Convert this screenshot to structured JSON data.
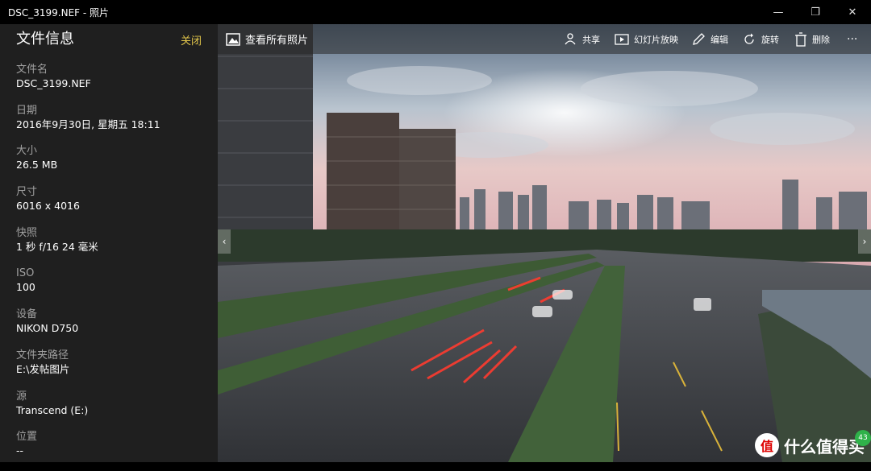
{
  "window": {
    "title": "DSC_3199.NEF - 照片",
    "minimize": "—",
    "maximize": "❐",
    "close": "✕"
  },
  "info_panel": {
    "title": "文件信息",
    "close_label": "关闭",
    "items": [
      {
        "label": "文件名",
        "value": "DSC_3199.NEF"
      },
      {
        "label": "日期",
        "value": "2016年9月30日, 星期五 18:11"
      },
      {
        "label": "大小",
        "value": "26.5 MB"
      },
      {
        "label": "尺寸",
        "value": "6016 x 4016"
      },
      {
        "label": "快照",
        "value": "1 秒 f/16 24 毫米"
      },
      {
        "label": "ISO",
        "value": "100"
      },
      {
        "label": "设备",
        "value": "NIKON D750"
      },
      {
        "label": "文件夹路径",
        "value": "E:\\发帖图片"
      },
      {
        "label": "源",
        "value": "Transcend (E:)"
      },
      {
        "label": "位置",
        "value": "--"
      }
    ]
  },
  "toolbar": {
    "view_all": "查看所有照片",
    "share": "共享",
    "slideshow": "幻灯片放映",
    "edit": "编辑",
    "rotate": "旋转",
    "delete": "删除",
    "more": "···"
  },
  "nav": {
    "prev": "‹",
    "next": "›"
  },
  "watermark": {
    "logo": "值",
    "text": "什么值得买",
    "badge": "43"
  }
}
